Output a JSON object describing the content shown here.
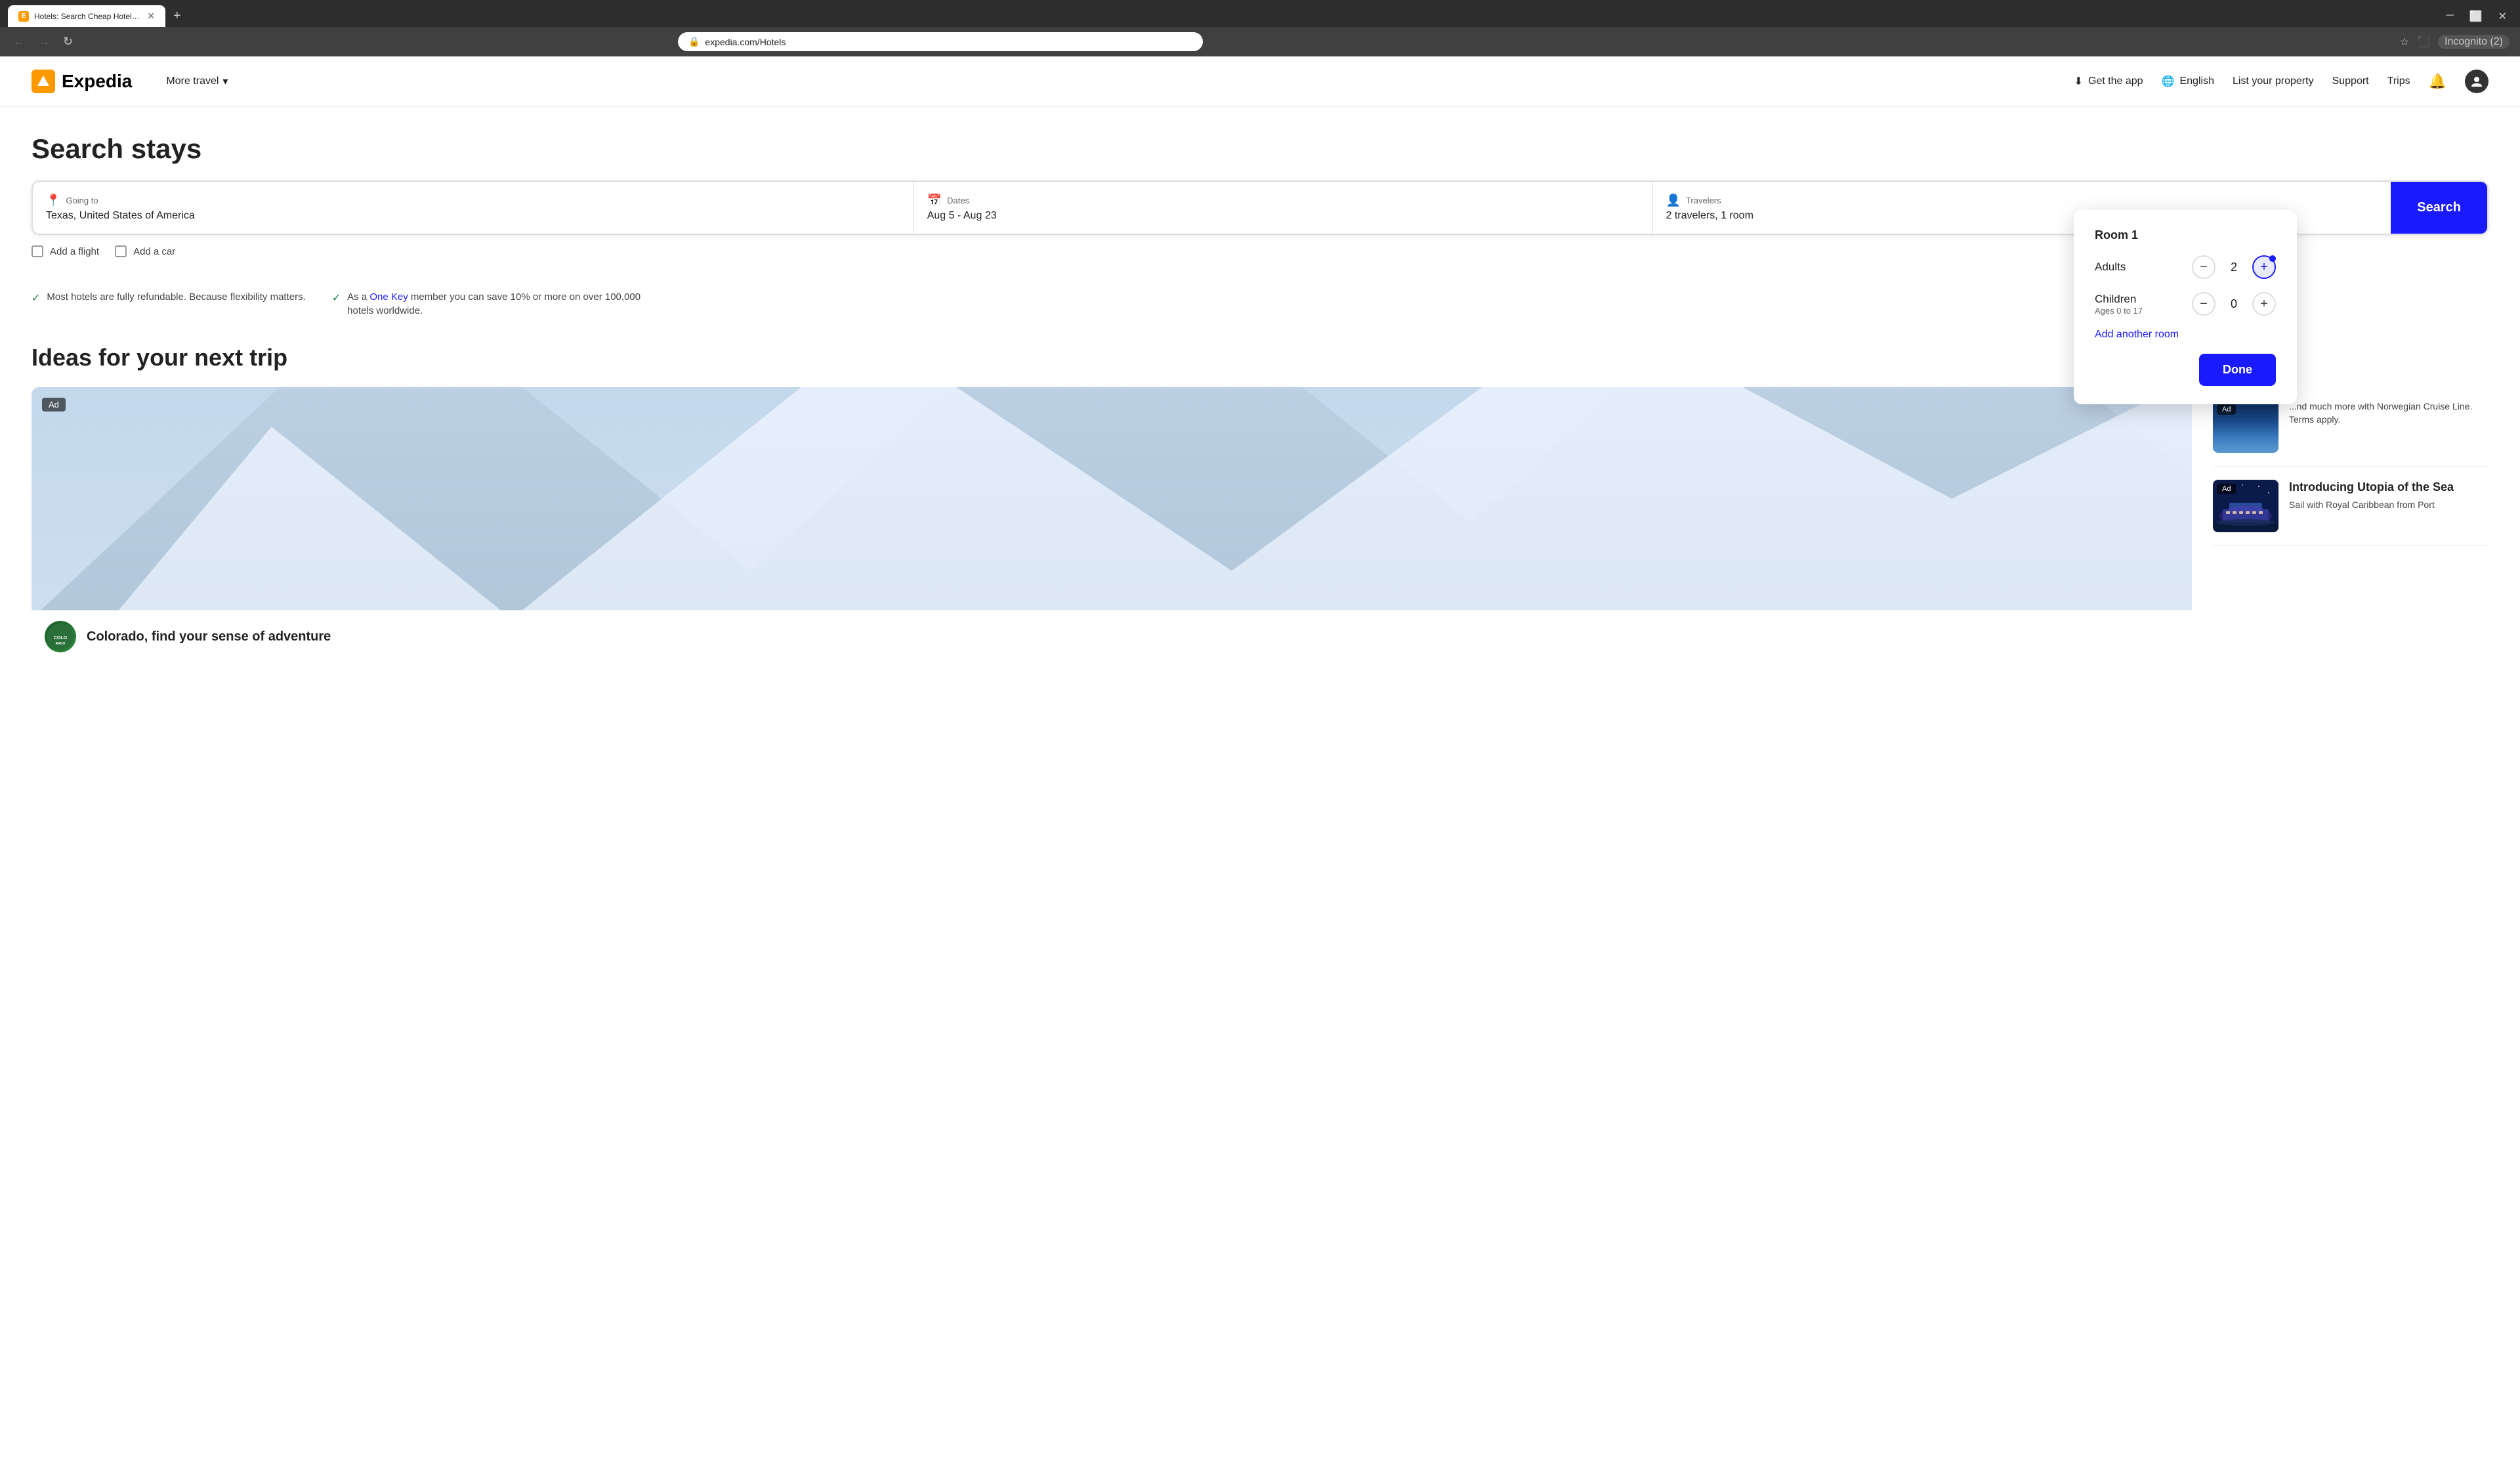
{
  "browser": {
    "tab": {
      "favicon_text": "E",
      "title": "Hotels: Search Cheap Hotels, ..."
    },
    "address": "expedia.com/Hotels",
    "incognito_label": "Incognito (2)"
  },
  "header": {
    "logo_text": "Expedia",
    "more_travel_label": "More travel",
    "get_app_label": "Get the app",
    "language_label": "English",
    "list_property_label": "List your property",
    "support_label": "Support",
    "trips_label": "Trips"
  },
  "search": {
    "title": "Search stays",
    "destination_label": "Going to",
    "destination_value": "Texas, United States of America",
    "dates_label": "Dates",
    "dates_value": "Aug 5 - Aug 23",
    "travelers_label": "Travelers",
    "travelers_value": "2 travelers, 1 room",
    "search_button_label": "Search",
    "add_flight_label": "Add a flight",
    "add_car_label": "Add a car"
  },
  "benefits": [
    {
      "text": "Most hotels are fully refundable. Because flexibility matters."
    },
    {
      "text": "As a One Key member you can save 10% or more on over 100,000 hotels worldwide.",
      "link_text": "One Key",
      "has_link": true
    }
  ],
  "travelers_dropdown": {
    "title": "Room 1",
    "adults_label": "Adults",
    "adults_value": 2,
    "children_label": "Children",
    "children_sublabel": "Ages 0 to 17",
    "children_value": 0,
    "add_room_label": "Add another room",
    "done_label": "Done"
  },
  "ideas": {
    "title": "Ideas for your next trip",
    "main_card": {
      "ad_label": "Ad",
      "caption": "Colorado, find your sense of adventure"
    },
    "side_cards": [
      {
        "ad_label": "Ad",
        "title": "Introducing Utopia of the Sea",
        "description": "Sail with Royal Caribbean from Port"
      }
    ]
  },
  "colors": {
    "primary_blue": "#1a1aff",
    "expedia_yellow": "#f90000",
    "one_key_blue": "#0066cc"
  }
}
